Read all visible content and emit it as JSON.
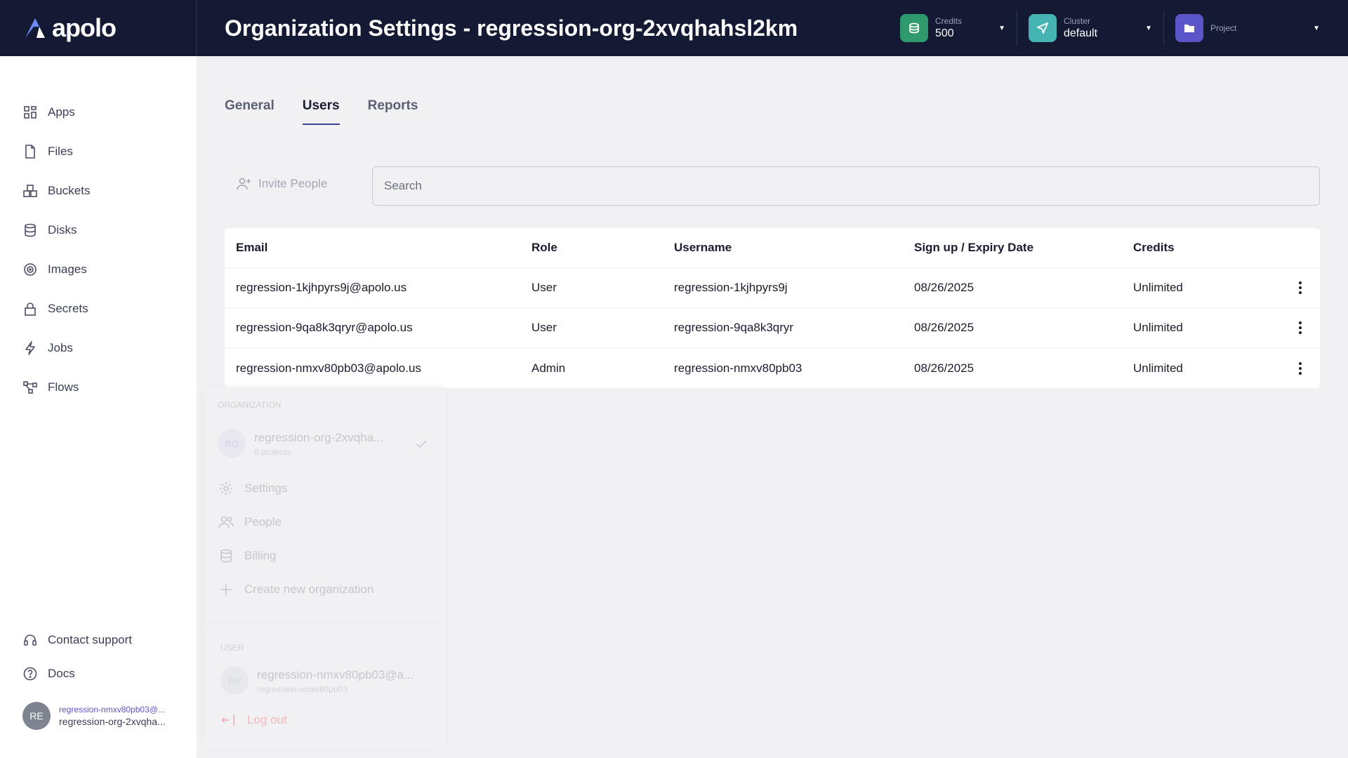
{
  "brand": {
    "name": "apolo"
  },
  "header": {
    "title": "Organization Settings - regression-org-2xvqhahsl2km",
    "credits": {
      "label": "Credits",
      "value": "500",
      "icon": "coins-icon",
      "color": "#2e9a6e"
    },
    "cluster": {
      "label": "Cluster",
      "value": "default",
      "icon": "send-icon",
      "color": "#46b3b3"
    },
    "project": {
      "label": "Project",
      "icon": "folder-icon",
      "color": "#5a55c8"
    }
  },
  "sidebar": {
    "items": [
      {
        "label": "Apps",
        "icon": "apps-icon"
      },
      {
        "label": "Files",
        "icon": "file-icon"
      },
      {
        "label": "Buckets",
        "icon": "buckets-icon"
      },
      {
        "label": "Disks",
        "icon": "database-icon"
      },
      {
        "label": "Images",
        "icon": "disc-icon"
      },
      {
        "label": "Secrets",
        "icon": "lock-icon"
      },
      {
        "label": "Jobs",
        "icon": "bolt-icon"
      },
      {
        "label": "Flows",
        "icon": "flow-icon"
      }
    ],
    "bottom": [
      {
        "label": "Contact support",
        "icon": "headset-icon"
      },
      {
        "label": "Docs",
        "icon": "help-icon"
      }
    ],
    "user": {
      "initials": "RE",
      "email": "regression-nmxv80pb03@...",
      "org": "regression-org-2xvqha..."
    }
  },
  "tabs": [
    {
      "label": "General",
      "active": false
    },
    {
      "label": "Users",
      "active": true
    },
    {
      "label": "Reports",
      "active": false
    }
  ],
  "toolbar": {
    "invite_label": "Invite People",
    "search_placeholder": "Search"
  },
  "table": {
    "headers": [
      "Email",
      "Role",
      "Username",
      "Sign up / Expiry Date",
      "Credits"
    ],
    "rows": [
      [
        "regression-1kjhpyrs9j@apolo.us",
        "User",
        "regression-1kjhpyrs9j",
        "08/26/2025",
        "Unlimited"
      ],
      [
        "regression-9qa8k3qryr@apolo.us",
        "User",
        "regression-9qa8k3qryr",
        "08/26/2025",
        "Unlimited"
      ],
      [
        "regression-nmxv80pb03@apolo.us",
        "Admin",
        "regression-nmxv80pb03",
        "08/26/2025",
        "Unlimited"
      ]
    ]
  },
  "dropdown": {
    "org_section": "ORGANIZATION",
    "org": {
      "initials": "RO",
      "name": "regression-org-2xvqha...",
      "sub": "0 projects"
    },
    "items": [
      {
        "label": "Settings",
        "icon": "gear-icon"
      },
      {
        "label": "People",
        "icon": "people-icon"
      },
      {
        "label": "Billing",
        "icon": "coins-icon"
      },
      {
        "label": "Create new organization",
        "icon": "plus-icon"
      }
    ],
    "user_section": "USER",
    "user": {
      "initials": "RE",
      "name": "regression-nmxv80pb03@a...",
      "sub": "regression-nmxv80pb03"
    },
    "logout": "Log out"
  }
}
